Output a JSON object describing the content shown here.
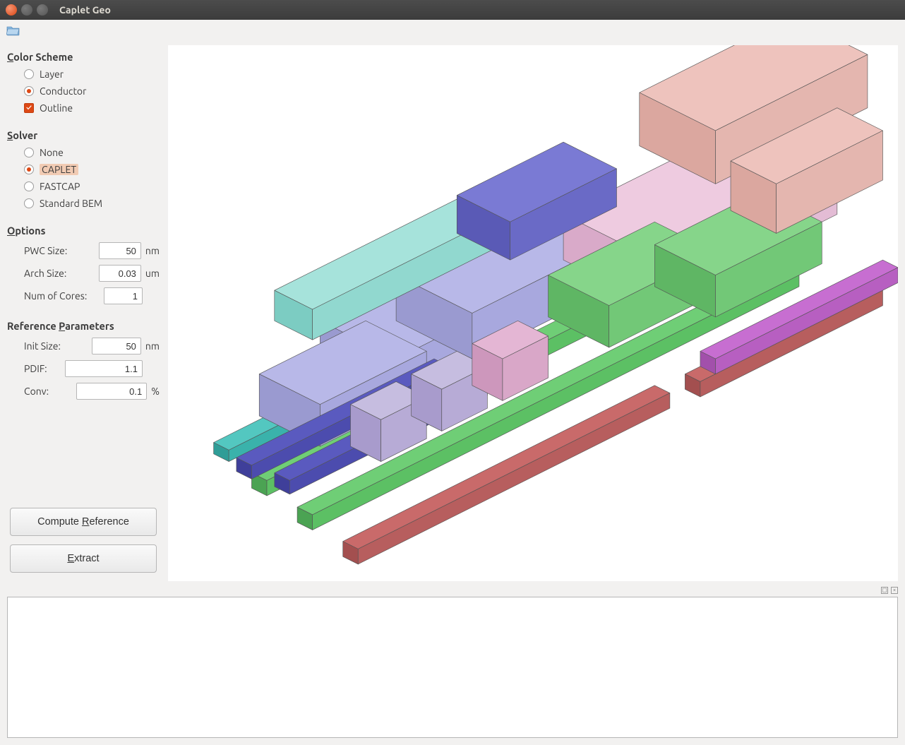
{
  "window": {
    "title": "Caplet Geo"
  },
  "sidebar": {
    "colorScheme": {
      "header": "Color Scheme",
      "headerAccel": "C",
      "layer": {
        "label": "Layer",
        "checked": false
      },
      "conductor": {
        "label": "Conductor",
        "checked": true
      },
      "outline": {
        "label": "Outline",
        "checked": true
      }
    },
    "solver": {
      "header": "Solver",
      "headerAccel": "S",
      "none": {
        "label": "None",
        "checked": false
      },
      "caplet": {
        "label": "CAPLET",
        "checked": true
      },
      "fastcap": {
        "label": "FASTCAP",
        "checked": false
      },
      "stdbem": {
        "label": "Standard BEM",
        "checked": false
      }
    },
    "options": {
      "header": "Options",
      "headerAccel": "O",
      "pwc": {
        "label": "PWC Size:",
        "value": "50",
        "unit": "nm"
      },
      "arch": {
        "label": "Arch Size:",
        "value": "0.03",
        "unit": "um"
      },
      "cores": {
        "label": "Num of Cores:",
        "value": "1",
        "unit": ""
      }
    },
    "reference": {
      "header": "Reference Parameters",
      "headerAccel": "P",
      "init": {
        "label": "Init Size:",
        "value": "50",
        "unit": "nm"
      },
      "pdif": {
        "label": "PDIF:",
        "value": "1.1",
        "unit": ""
      },
      "conv": {
        "label": "Conv:",
        "value": "0.1",
        "unit": "%"
      }
    },
    "buttons": {
      "compute": "Compute Reference",
      "computeAccel": "R",
      "extract": "Extract",
      "extractAccel": "E"
    }
  }
}
